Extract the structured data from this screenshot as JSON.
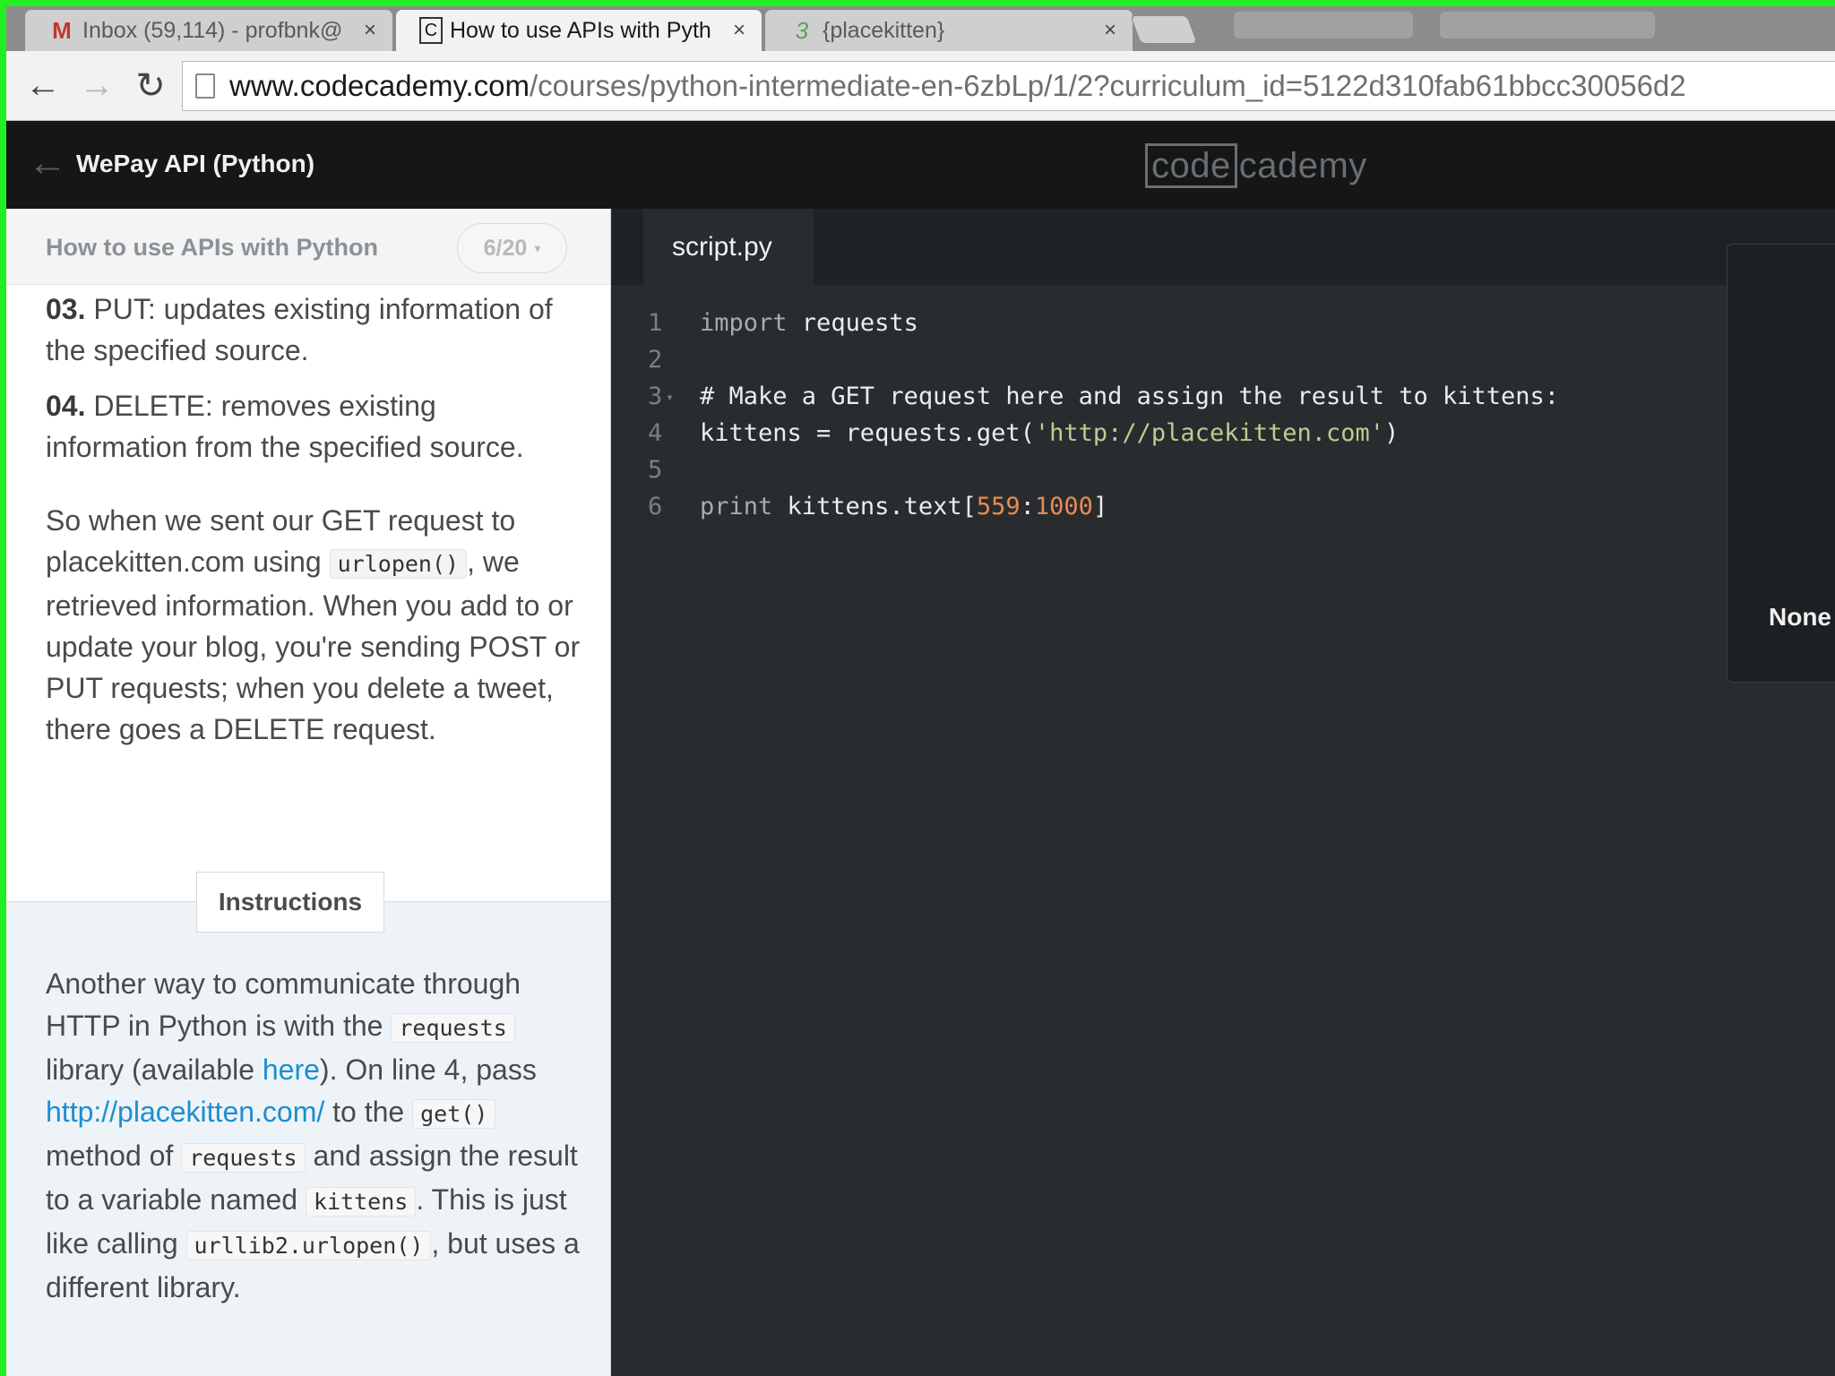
{
  "browser": {
    "tabs": [
      {
        "title": "Inbox (59,114) - profbnk@",
        "icon": "gmail-icon",
        "favicon": "M",
        "close": "×"
      },
      {
        "title": "How to use APIs with Pyth",
        "icon": "codecademy-favicon-icon",
        "favicon": "C",
        "close": "×"
      },
      {
        "title": "{placekitten}",
        "icon": "placekitten-favicon-icon",
        "favicon": "3",
        "close": "×"
      }
    ],
    "address": {
      "host": "www.codecademy.com",
      "path": "/courses/python-intermediate-en-6zbLp/1/2?curriculum_id=5122d310fab61bbcc30056d2"
    },
    "icons": {
      "back": "←",
      "forward": "→",
      "reload": "↻"
    }
  },
  "header": {
    "back_icon": "←",
    "course_title": "WePay API (Python)",
    "logo_boxed": "code",
    "logo_rest": "cademy"
  },
  "lesson": {
    "title": "How to use APIs with Python",
    "progress": "6/20",
    "progress_caret": "▾",
    "item3_num": "03.",
    "item3_text": " PUT: updates existing information of the specified source.",
    "item4_num": "04.",
    "item4_text": " DELETE: removes existing information from the specified source.",
    "para1_a": "So when we sent our GET request to placekitten.com using ",
    "para1_code": "urlopen()",
    "para1_b": ", we retrieved information. When you add to or update your blog, you're sending POST or PUT requests; when you delete a tweet, there goes a DELETE request.",
    "instructions_label": "Instructions",
    "instr_1": "Another way to communicate through HTTP in Python is with the ",
    "instr_code1": "requests",
    "instr_2": " library (available ",
    "instr_link1": "here",
    "instr_3": "). On line 4, pass ",
    "instr_link2": "http://placekitten.com/",
    "instr_4": " to the ",
    "instr_code2": "get()",
    "instr_5": " method of ",
    "instr_code3": "requests",
    "instr_6": " and assign the result to a variable named ",
    "instr_code4": "kittens",
    "instr_7": ". This is just like calling ",
    "instr_code5": "urllib2.urlopen()",
    "instr_8": ", but uses a different library."
  },
  "editor": {
    "filename": "script.py",
    "fold_marker": "▾",
    "line_numbers": [
      "1",
      "2",
      "3",
      "4",
      "5",
      "6"
    ],
    "l1_kw": "import",
    "l1_rest": " requests",
    "l3_comment": "# Make a GET request here and assign the result to kittens:",
    "l4_a": "kittens = requests.get(",
    "l4_str": "'http://placekitten.com'",
    "l4_b": ")",
    "l6_kw": "print",
    "l6_a": " kittens.text[",
    "l6_n1": "559",
    "l6_colon": ":",
    "l6_n2": "1000",
    "l6_b": "]"
  },
  "output": {
    "text": "None"
  }
}
